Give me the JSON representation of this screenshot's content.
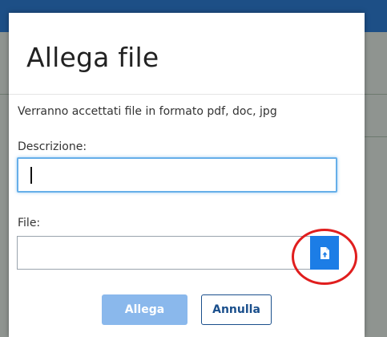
{
  "dialog": {
    "title": "Allega file",
    "info": "Verranno accettati file in formato pdf, doc, jpg",
    "description_label": "Descrizione:",
    "description_value": "",
    "file_label": "File:",
    "file_value": "",
    "upload_icon": "file-upload-icon",
    "submit_label": "Allega",
    "cancel_label": "Annulla"
  },
  "colors": {
    "topbar": "#1d4f86",
    "upload_button": "#1c7de6",
    "submit_disabled": "#8ab8ec",
    "cancel_border": "#1a4f8c",
    "annotation": "#e01e1e"
  }
}
